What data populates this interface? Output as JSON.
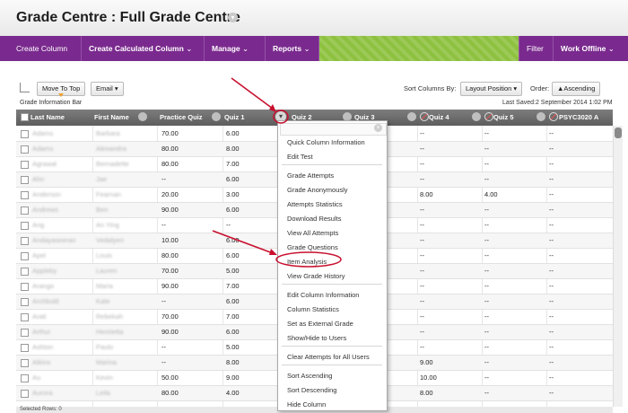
{
  "page": {
    "title": "Grade Centre : Full Grade Centre"
  },
  "action_bar": {
    "create_column": "Create Column",
    "create_calculated": "Create Calculated Column",
    "manage": "Manage",
    "reports": "Reports",
    "filter": "Filter",
    "work_offline": "Work Offline"
  },
  "toolbar": {
    "move_to_top": "Move To Top",
    "email": "Email",
    "sort_columns_by": "Sort Columns By:",
    "layout_position": "Layout Position",
    "order": "Order:",
    "ascending": "▲Ascending",
    "info_bar": "Grade Information Bar",
    "last_saved": "Last Saved:2 September 2014 1:02 PM"
  },
  "columns": [
    "Last Name",
    "First Name",
    "Practice Quiz",
    "Quiz 1",
    "Quiz 2",
    "Quiz 3",
    "Quiz 4",
    "Quiz 5",
    "PSYC3020 A"
  ],
  "rows": [
    {
      "last": "Adams",
      "first": "Barbara",
      "practice": "70.00",
      "q1": "6.00",
      "q4": "--",
      "q5": "--",
      "psyc": "--"
    },
    {
      "last": "Adams",
      "first": "Alexandra",
      "practice": "80.00",
      "q1": "8.00",
      "q4": "--",
      "q5": "--",
      "psyc": "--"
    },
    {
      "last": "Agrawal",
      "first": "Bernadette",
      "practice": "80.00",
      "q1": "7.00",
      "q4": "--",
      "q5": "--",
      "psyc": "--"
    },
    {
      "last": "Ahn",
      "first": "Jae",
      "practice": "--",
      "q1": "6.00",
      "q4": "--",
      "q5": "--",
      "psyc": "--"
    },
    {
      "last": "Anderson",
      "first": "Fearnan",
      "practice": "20.00",
      "q1": "3.00",
      "q4": "8.00",
      "q5": "4.00",
      "psyc": "--"
    },
    {
      "last": "Andrews",
      "first": "Ben",
      "practice": "90.00",
      "q1": "6.00",
      "q4": "--",
      "q5": "--",
      "psyc": "--"
    },
    {
      "last": "Ang",
      "first": "An Ying",
      "practice": "--",
      "q1": "--",
      "q4": "--",
      "q5": "--",
      "psyc": "--"
    },
    {
      "last": "Andayaseeran",
      "first": "Vedalyen",
      "practice": "10.00",
      "q1": "6.00",
      "q4": "--",
      "q5": "--",
      "psyc": "--"
    },
    {
      "last": "Apel",
      "first": "Louis",
      "practice": "80.00",
      "q1": "6.00",
      "q4": "--",
      "q5": "--",
      "psyc": "--"
    },
    {
      "last": "Appleby",
      "first": "Lauren",
      "practice": "70.00",
      "q1": "5.00",
      "q4": "--",
      "q5": "--",
      "psyc": "--"
    },
    {
      "last": "Arango",
      "first": "Maria",
      "practice": "90.00",
      "q1": "7.00",
      "q4": "--",
      "q5": "--",
      "psyc": "--"
    },
    {
      "last": "Archbold",
      "first": "Kate",
      "practice": "--",
      "q1": "6.00",
      "q4": "--",
      "q5": "--",
      "psyc": "--"
    },
    {
      "last": "Arati",
      "first": "Rebekah",
      "practice": "70.00",
      "q1": "7.00",
      "q4": "--",
      "q5": "--",
      "psyc": "--"
    },
    {
      "last": "Arthur",
      "first": "Henrietta",
      "practice": "90.00",
      "q1": "6.00",
      "q4": "--",
      "q5": "--",
      "psyc": "--"
    },
    {
      "last": "Ashton",
      "first": "Paulo",
      "practice": "--",
      "q1": "5.00",
      "q4": "--",
      "q5": "--",
      "psyc": "--"
    },
    {
      "last": "Atkins",
      "first": "Marina",
      "practice": "--",
      "q1": "8.00",
      "q4": "9.00",
      "q5": "--",
      "psyc": "--"
    },
    {
      "last": "Au",
      "first": "Kevin",
      "practice": "50.00",
      "q1": "9.00",
      "q4": "10.00",
      "q5": "--",
      "psyc": "--"
    },
    {
      "last": "Aurora",
      "first": "Leila",
      "practice": "80.00",
      "q1": "4.00",
      "q4": "8.00",
      "q5": "--",
      "psyc": "--"
    }
  ],
  "context_menu": {
    "items": [
      "Quick Column Information",
      "Edit Test",
      "Grade Attempts",
      "Grade Anonymously",
      "Attempts Statistics",
      "Download Results",
      "View All Attempts",
      "Grade Questions",
      "Item Analysis",
      "View Grade History",
      "Edit Column Information",
      "Column Statistics",
      "Set as External Grade",
      "Show/Hide to Users",
      "Clear Attempts for All Users",
      "Sort Ascending",
      "Sort Descending",
      "Hide Column"
    ]
  },
  "status": {
    "selected_rows": "Selected Rows: 0"
  },
  "colors": {
    "action_bar": "#7a2a8e",
    "accent_green": "#8dc13f",
    "annotation_red": "#c8102e"
  }
}
